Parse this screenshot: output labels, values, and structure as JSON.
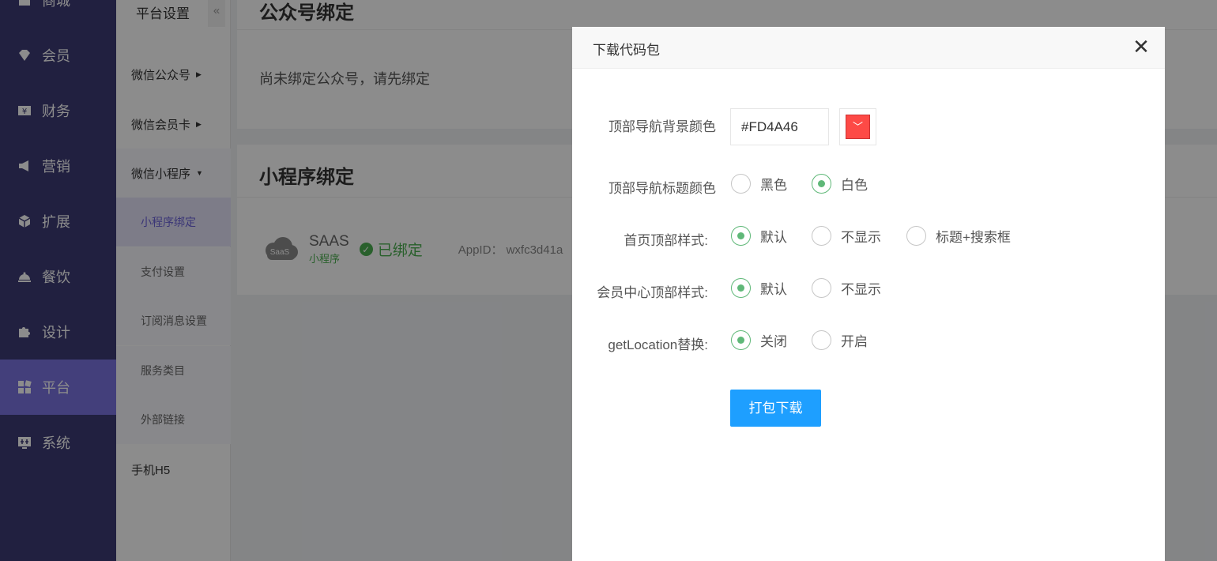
{
  "main_nav": {
    "items": [
      {
        "label": "商城",
        "icon": "shop-icon"
      },
      {
        "label": "会员",
        "icon": "member-icon"
      },
      {
        "label": "财务",
        "icon": "finance-icon"
      },
      {
        "label": "营销",
        "icon": "megaphone-icon"
      },
      {
        "label": "扩展",
        "icon": "cube-icon"
      },
      {
        "label": "餐饮",
        "icon": "dish-icon"
      },
      {
        "label": "设计",
        "icon": "puzzle-icon"
      },
      {
        "label": "平台",
        "icon": "grid-icon"
      },
      {
        "label": "系统",
        "icon": "system-icon"
      }
    ],
    "active": "平台"
  },
  "sub_nav": {
    "title": "平台设置",
    "collapse_icon": "«",
    "groups": {
      "wechat_official": "微信公众号",
      "wechat_card": "微信会员卡",
      "wechat_mini": "微信小程序",
      "mobile_h5": "手机H5"
    },
    "children": {
      "mini_bind": "小程序绑定",
      "payment": "支付设置",
      "subscribe": "订阅消息设置",
      "service_category": "服务类目",
      "external_link": "外部链接"
    }
  },
  "content": {
    "official_card": {
      "title": "公众号绑定",
      "notice": "尚未绑定公众号，请先绑定"
    },
    "mini_card": {
      "title": "小程序绑定",
      "logo_text": "SaaS",
      "name": "SAAS",
      "type": "小程序",
      "status": "已绑定",
      "appid": "AppID： wxfc3d41a"
    }
  },
  "modal": {
    "title": "下载代码包",
    "close_icon": "✕",
    "fields": {
      "nav_bg_color": {
        "label": "顶部导航背景颜色",
        "value": "#FD4A46",
        "picker_icon": "﹀"
      },
      "nav_title_color": {
        "label": "顶部导航标题颜色",
        "options": [
          "黑色",
          "白色"
        ],
        "selected": "白色"
      },
      "home_top_style": {
        "label": "首页顶部样式:",
        "options": [
          "默认",
          "不显示",
          "标题+搜索框"
        ],
        "selected": "默认"
      },
      "member_top_style": {
        "label": "会员中心顶部样式:",
        "options": [
          "默认",
          "不显示"
        ],
        "selected": "默认"
      },
      "get_location": {
        "label": "getLocation替换:",
        "options": [
          "关闭",
          "开启"
        ],
        "selected": "关闭"
      }
    },
    "submit_label": "打包下载"
  },
  "colors": {
    "sidebar_bg": "#3d3b75",
    "sidebar_active": "#7a74e0",
    "accent_green": "#5fb878",
    "primary_blue": "#1e9fff",
    "nav_bg_swatch": "#FD4A46"
  }
}
